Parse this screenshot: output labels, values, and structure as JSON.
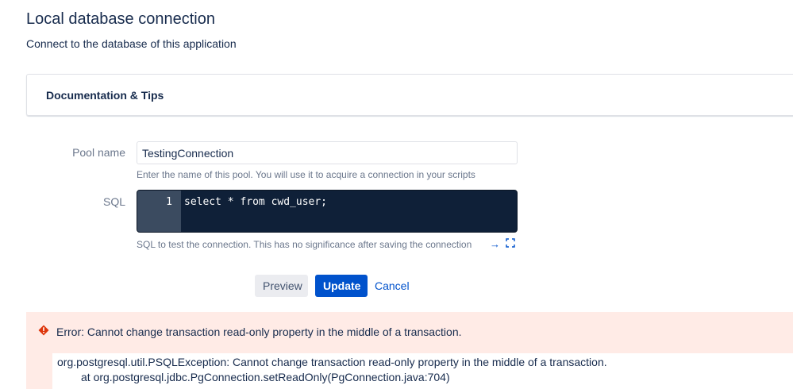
{
  "header": {
    "title": "Local database connection",
    "subtitle": "Connect to the database of this application"
  },
  "documentation": {
    "title": "Documentation & Tips"
  },
  "form": {
    "pool_name": {
      "label": "Pool name",
      "value": "TestingConnection",
      "help": "Enter the name of this pool. You will use it to acquire a connection in your scripts"
    },
    "sql": {
      "label": "SQL",
      "line_number": "1",
      "code": "select * from cwd_user;",
      "help": "SQL to test the connection. This has no significance after saving the connection"
    }
  },
  "icons": {
    "arrow": "→",
    "fullscreen": "⛶"
  },
  "actions": {
    "preview_label": "Preview",
    "update_label": "Update",
    "cancel_label": "Cancel"
  },
  "error": {
    "title": "Error: Cannot change transaction read-only property in the middle of a transaction.",
    "stack": [
      "org.postgresql.util.PSQLException: Cannot change transaction read-only property in the middle of a transaction.",
      "at org.postgresql.jdbc.PgConnection.setReadOnly(PgConnection.java:704)"
    ]
  },
  "colors": {
    "primary": "#0052cc",
    "error_background": "#ffebe6",
    "error_icon": "#de350b",
    "editor_background": "#0f2038"
  }
}
